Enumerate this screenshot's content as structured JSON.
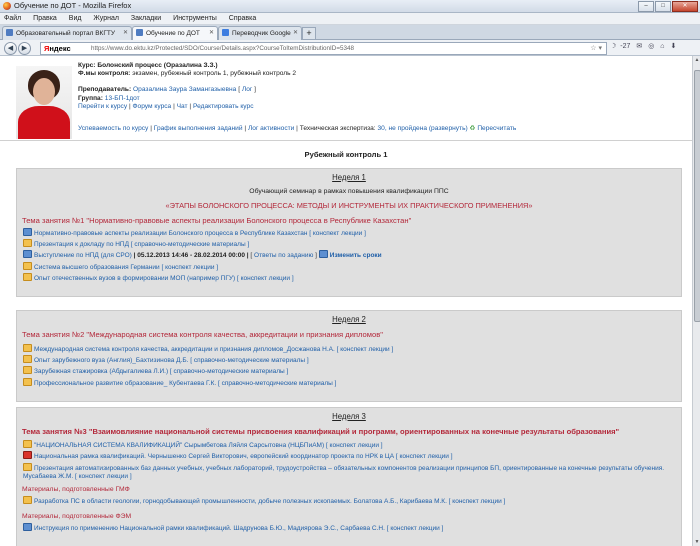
{
  "window": {
    "title": "Обучение по ДОТ - Mozilla Firefox",
    "controls": [
      "–",
      "□",
      "✕"
    ]
  },
  "menu": [
    "Файл",
    "Правка",
    "Вид",
    "Журнал",
    "Закладки",
    "Инструменты",
    "Справка"
  ],
  "tabs": [
    {
      "label": "Образовательный портал ВКГТУ"
    },
    {
      "label": "Обучение по ДОТ"
    },
    {
      "label": "Переводчик Google"
    }
  ],
  "tab_new": "+",
  "toolbar": {
    "yandex_y": "Я",
    "yandex_rest": "ндекс",
    "url": "https://www.do.ektu.kz/Protected/SDO/Course/Details.aspx?CourseToItemDistributionID=5348",
    "temp": "-27"
  },
  "course": {
    "course_label": "Курс:",
    "course_name": "Болонский процесс (Оразалина З.З.)",
    "forms_label": "Ф.мы контроля:",
    "forms_value": "экзамен, рубежный контроль 1, рубежный контроль 2",
    "teacher_label": "Преподаватель:",
    "teacher_name": "Оразалина Заура Замангазыевна",
    "teacher_log": "Лог",
    "group_label": "Группа:",
    "group_value": "13-БП-1дот",
    "links": [
      "Перейти к курсу",
      "Форум курса",
      "Чат",
      "Редактировать курс"
    ],
    "bottom_links": [
      "Успеваемость по курсу",
      "График выполнения заданий",
      "Лог активности"
    ],
    "expertise_label": "Техническая экспертиза:",
    "expertise_value": "30, не пройдена (развернуть)",
    "recalc": "Пересчитать"
  },
  "section_title": "Рубежный контроль 1",
  "weeks": [
    {
      "title": "Неделя 1",
      "subtitle": "Обучающий семинар  в рамках  повышения квалификации ППС",
      "subtitle2": "«ЭТАПЫ БОЛОНСКОГО ПРОЦЕССА: МЕТОДЫ И ИНСТРУМЕНТЫ ИХ ПРАКТИЧЕСКОГО ПРИМЕНЕНИЯ»",
      "topic": "Тема занятия №1 \"Нормативно-правовые аспекты реализации Болонского процесса  в Республике Казахстан\"",
      "items": [
        "Нормативно-правовые аспекты реализации Болонского процесса в Республике Казахстан [ конспект лекции ]",
        "Презентация к докладу по НПД [ справочно-методические материалы ]",
        "Выступление по НПД (для СРО)",
        "Система высшего образования Германии [ конспект лекции ]",
        "Опыт отечественных вузов в формировании МОП (например ПГУ) [ конспект лекции ]"
      ],
      "assignment_dates": "| 05.12.2013 14:46 - 28.02.2014 00:00 |",
      "assignment_answers": "Ответы по заданию",
      "assignment_edit": "Изменить сроки"
    },
    {
      "title": "Неделя 2",
      "topic": "Тема занятия №2 \"Международная система контроля качества, аккредитации и признания дипломов\"",
      "items": [
        "Международная система контроля качества, аккредитации и признания дипломов_Досжанова Н.А. [ конспект лекции ]",
        "Опыт зарубежного вуза (Англия)_Бахтизинова Д.Б. [ справочно-методические материалы ]",
        "Зарубежная стажировка (Абдыгалиева Л.И.) [ справочно-методические материалы ]",
        "Профессиональное развитие образование_ Кубентаева Г.К. [ справочно-методические материалы ]"
      ]
    },
    {
      "title": "Неделя 3",
      "topic": "Тема занятия №3 \"Взаимовлияние национальной системы присвоения квалификаций и программ, ориентированных на конечные результаты образования\"",
      "items": [
        "\"НАЦИОНАЛЬНАЯ СИСТЕМА КВАЛИФИКАЦИЙ\" Сырымбетова Ляйля Сарсытовна (НЦБПиАМ) [ конспект лекции ]",
        "Национальная рамка квалификаций. Чернышенко Сергей Викторович, европейский координатор проекта по НРК в ЦА [ конспект лекции ]",
        "Презентация автоматизированных баз данных учебных, учебных лабораторий, трудоустройства – обязательных компонентов реализации принципов БП, ориентированные на конечные результаты обучения. Мусабаева Ж.М. [ конспект лекции ]"
      ],
      "sub1": "Материалы, подготовленные ГМФ",
      "items2": [
        "Разработка ПС в области геологии, горнодобывающей промышленности, добыче полезных ископаемых. Болатова А.Б., Карибаева М.К. [ конспект лекции ]"
      ],
      "sub2": "Материалы, подготовленные ФЭМ",
      "items3": [
        "Инструкция по применению Национальной рамки квалификаций. Шадрунова Б.Ю., Мадиярова Э.С., Сарбаева С.Н. [ конспект лекции ]"
      ]
    }
  ]
}
